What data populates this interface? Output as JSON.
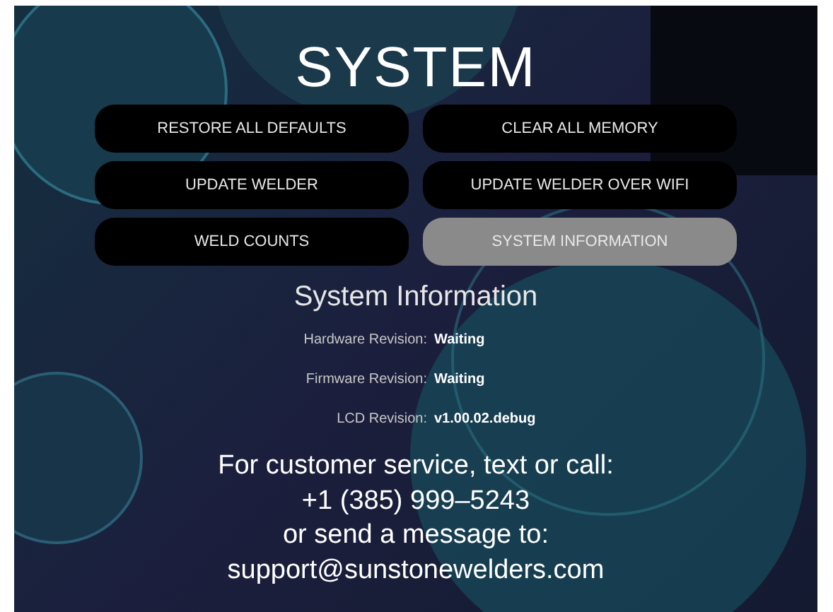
{
  "title": "SYSTEM",
  "buttons": [
    {
      "label": "RESTORE ALL DEFAULTS",
      "selected": false
    },
    {
      "label": "CLEAR ALL MEMORY",
      "selected": false
    },
    {
      "label": "UPDATE WELDER",
      "selected": false
    },
    {
      "label": "UPDATE WELDER OVER WIFI",
      "selected": false
    },
    {
      "label": "WELD COUNTS",
      "selected": false
    },
    {
      "label": "SYSTEM INFORMATION",
      "selected": true
    }
  ],
  "info": {
    "heading": "System Information",
    "rows": [
      {
        "label": "Hardware Revision:",
        "value": "Waiting"
      },
      {
        "label": "Firmware Revision:",
        "value": "Waiting"
      },
      {
        "label": "LCD Revision:",
        "value": "v1.00.02.debug"
      }
    ]
  },
  "contact": [
    "For customer service, text or call:",
    "+1 (385) 999–5243",
    "or send a message to:",
    "support@sunstonewelders.com"
  ]
}
